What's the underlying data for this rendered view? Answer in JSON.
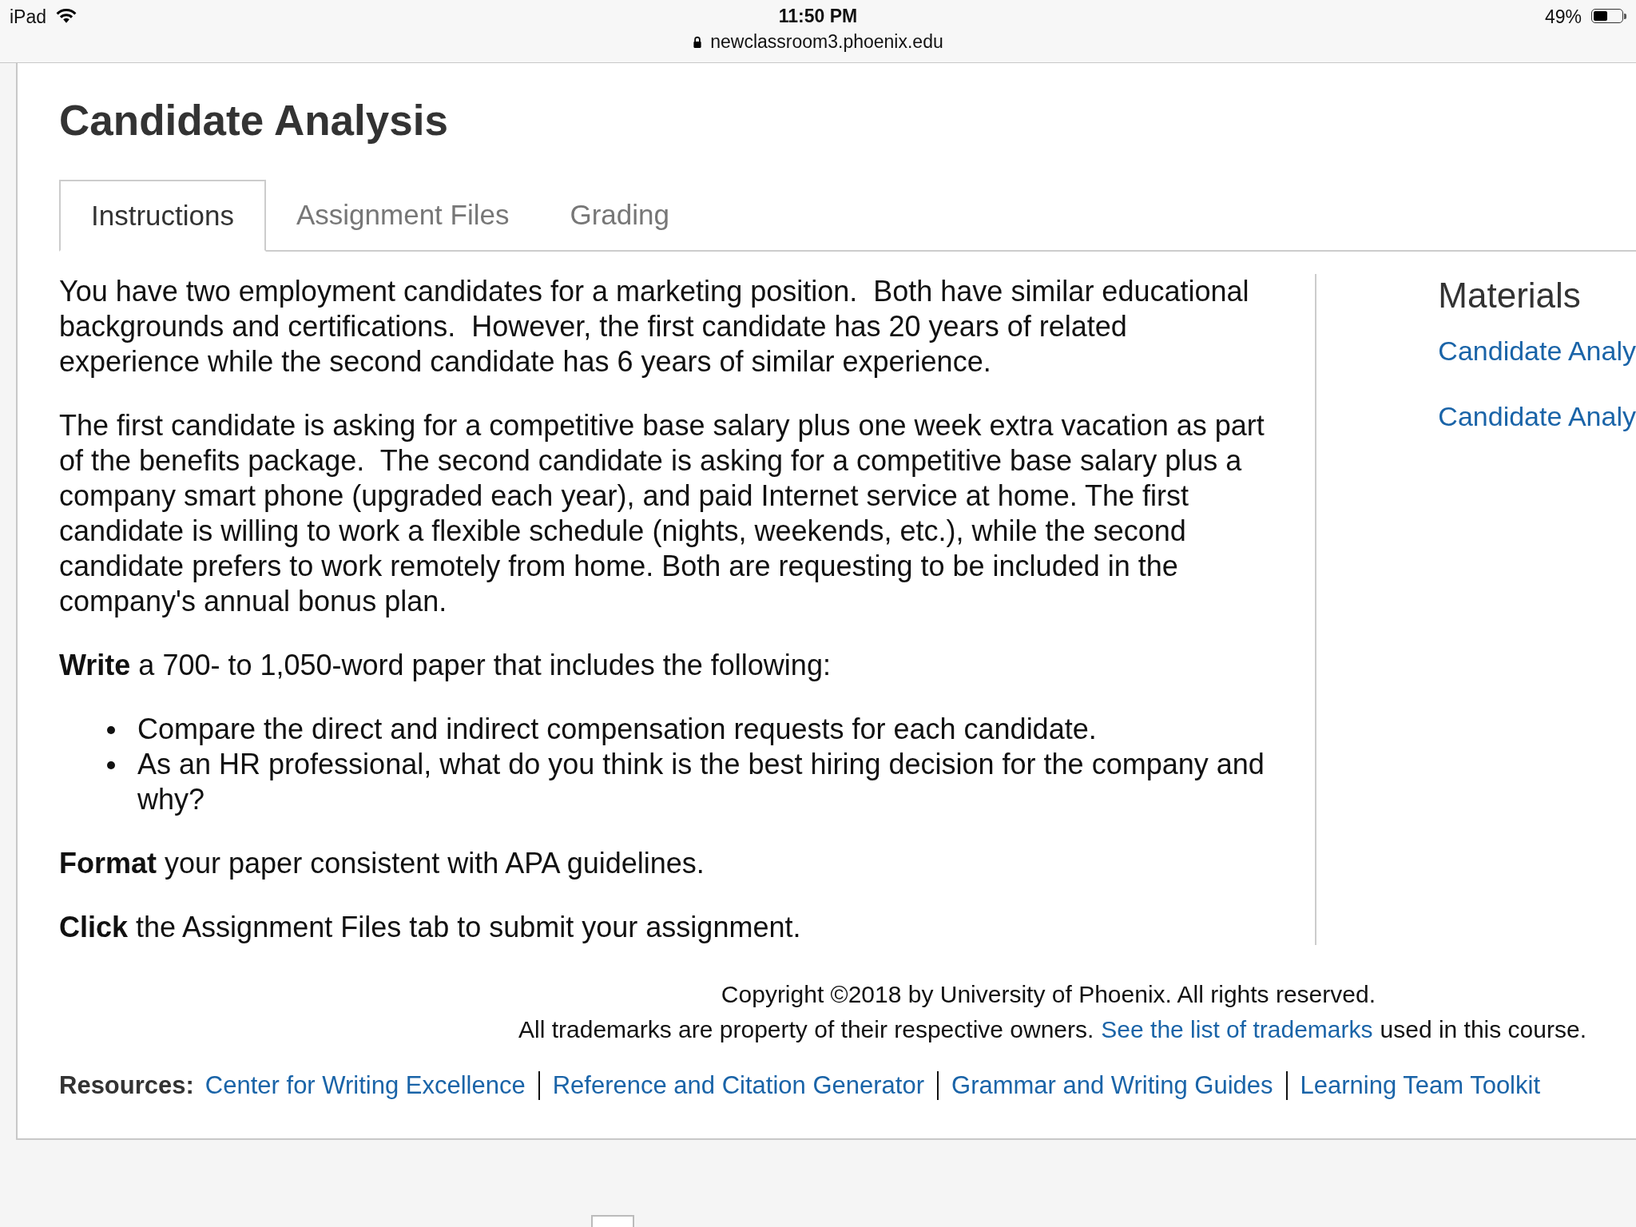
{
  "status_bar": {
    "device": "iPad",
    "time": "11:50 PM",
    "url": "newclassroom3.phoenix.edu",
    "battery": "49%"
  },
  "page": {
    "title": "Candidate Analysis",
    "tabs": [
      {
        "label": "Instructions",
        "selected": true
      },
      {
        "label": "Assignment Files",
        "selected": false
      },
      {
        "label": "Grading",
        "selected": false
      }
    ],
    "paragraphs": [
      "You have two employment candidates for a marketing position.  Both have similar educational backgrounds and certifications.  However, the first candidate has 20 years of related experience while the second candidate has 6 years of similar experience.",
      "The first candidate is asking for a competitive base salary plus one week extra vacation as part of the benefits package.  The second candidate is asking for a competitive base salary plus a company smart phone (upgraded each year), and paid Internet service at home. The first candidate is willing to work a flexible schedule (nights, weekends, etc.), while the second candidate prefers to work remotely from home. Both are requesting to be included in the company's annual bonus plan.",
      "**Write** a 700- to 1,050-word paper that includes the following:"
    ],
    "bullets": [
      "Compare the direct and indirect compensation requests for each candidate.",
      "As an HR professional, what do you think is the best hiring decision for the company and why?"
    ],
    "closing_paragraphs": [
      "**Format** your paper consistent with APA guidelines.",
      "**Click** the Assignment Files tab to submit your assignment."
    ],
    "materials": {
      "title": "Materials",
      "links": [
        "Candidate Analy",
        "Candidate Analy"
      ]
    },
    "copyright": "Copyright ©2018 by University of Phoenix. All rights reserved.",
    "trademarks": {
      "before": "All trademarks are property of their respective owners.",
      "link": "See the list of trademarks",
      "after": "used in this course."
    },
    "resources": {
      "label": "Resources:",
      "links": [
        "Center for Writing Excellence",
        "Reference and Citation Generator",
        "Grammar and Writing Guides",
        "Learning Team Toolkit"
      ]
    }
  }
}
